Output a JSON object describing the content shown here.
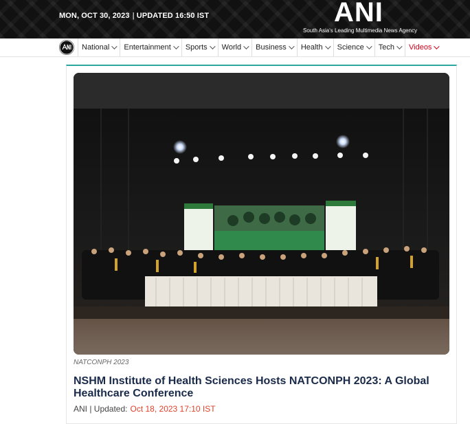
{
  "header": {
    "date": "MON, OCT 30, 2023",
    "separator": "|",
    "updated": "UPDATED 16:50 IST",
    "brand": "ANI",
    "tagline": "South Asia's Leading Multimedia News Agency"
  },
  "nav": {
    "items": [
      {
        "label": "National"
      },
      {
        "label": "Entertainment"
      },
      {
        "label": "Sports"
      },
      {
        "label": "World"
      },
      {
        "label": "Business"
      },
      {
        "label": "Health"
      },
      {
        "label": "Science"
      },
      {
        "label": "Tech"
      },
      {
        "label": "Videos"
      }
    ],
    "active_color": "#d0021b"
  },
  "article": {
    "image_caption": "NATCONPH 2023",
    "headline": "NSHM Institute of Health Sciences Hosts NATCONPH 2023: A Global Healthcare Conference",
    "source": "ANI | Updated:",
    "updated_time": "Oct 18, 2023 17:10 IST",
    "accent_color": "#2aa8a0"
  }
}
